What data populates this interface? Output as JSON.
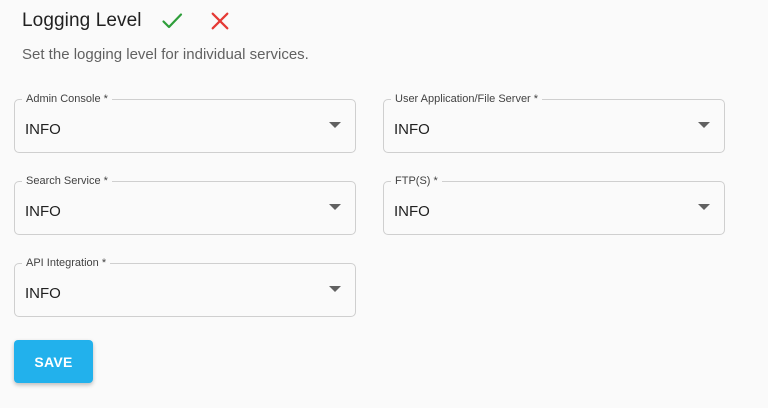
{
  "header": {
    "title": "Logging Level",
    "confirm_icon": "check-icon",
    "cancel_icon": "close-icon",
    "confirm_color": "#2e9e3a",
    "cancel_color": "#e53935"
  },
  "subtitle": "Set the logging level for individual services.",
  "fields": [
    {
      "label": "Admin Console *",
      "value": "INFO"
    },
    {
      "label": "User Application/File Server *",
      "value": "INFO"
    },
    {
      "label": "Search Service *",
      "value": "INFO"
    },
    {
      "label": "FTP(S) *",
      "value": "INFO"
    },
    {
      "label": "API Integration *",
      "value": "INFO"
    }
  ],
  "save_button": {
    "label": "SAVE",
    "color": "#22b1ec"
  }
}
